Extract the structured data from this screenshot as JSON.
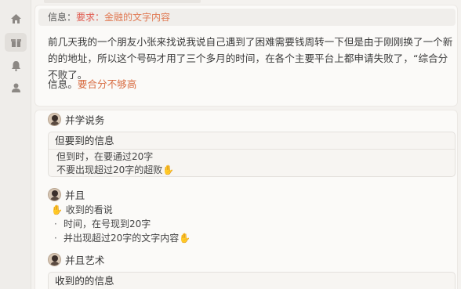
{
  "sidebar": {
    "items": [
      {
        "icon": "home-icon"
      },
      {
        "icon": "gift-icon"
      },
      {
        "icon": "bell-icon"
      },
      {
        "icon": "user-icon"
      }
    ]
  },
  "post": {
    "info_prefix": "信息：",
    "info_required_label": "要求：",
    "info_required_value": "金融的文字内容",
    "body": "前几天我的一个朋友小张来找说我说自己遇到了困难需要钱周转一下但是由于刚刚换了一个新的的地址，所以这个号码才用了三个多月的时间，在各个主要平台上都申请失败了，“综合分不败了。",
    "info_line_prefix": "信息。",
    "info_line_highlight": "要合分不够高"
  },
  "replies": [
    {
      "author": "并学说务",
      "box_title": "但要到的信息",
      "lines": [
        "但到时，在要通过20字",
        "不要出现超过20字的超败"
      ],
      "line2_emoji": "✋"
    },
    {
      "author": "并且",
      "lead_emoji": "✋",
      "lead_text": "收到的看说",
      "bullets": [
        "时间，在号现到20字",
        "并出现超过20字的文字内容"
      ],
      "bullet2_emoji": "✋"
    },
    {
      "author": "并且艺术",
      "box_title": "收到的的信息"
    }
  ],
  "colors": {
    "required": "#e05a4f",
    "highlight": "#d86d43",
    "background": "#f4f2ef"
  }
}
